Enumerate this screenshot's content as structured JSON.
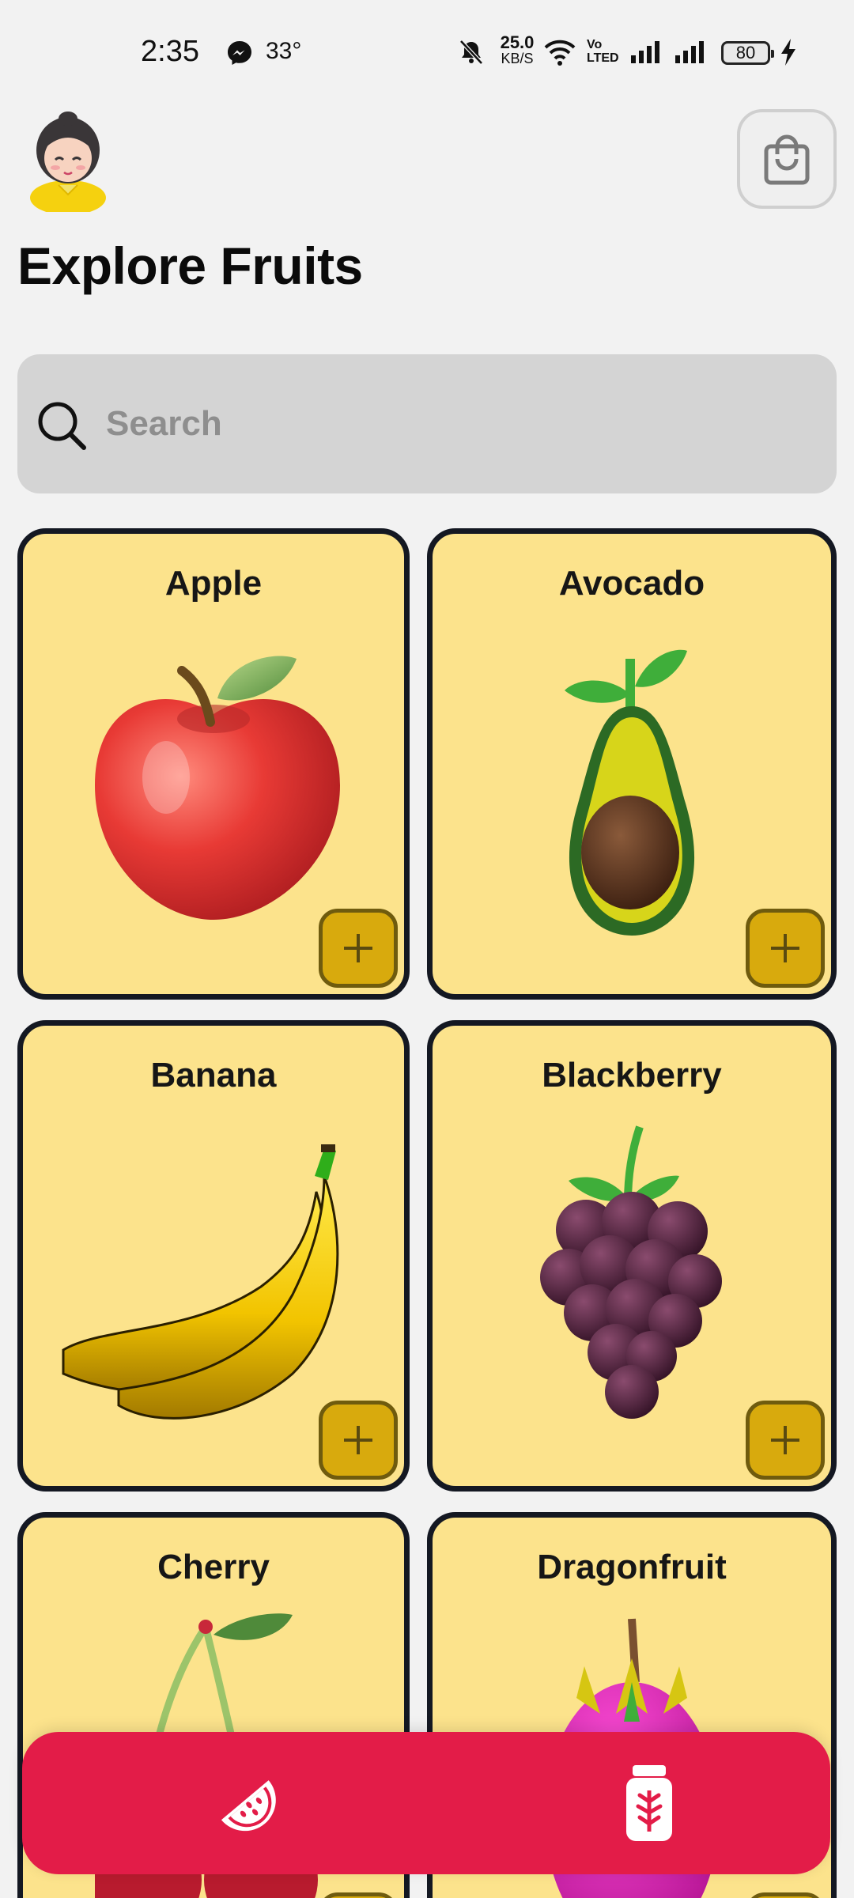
{
  "status_bar": {
    "time": "2:35",
    "temperature": "33°",
    "net_speed": "25.0",
    "net_unit": "KB/S",
    "volte": [
      "Vo",
      "LTED"
    ],
    "battery": "80"
  },
  "header": {
    "title": "Explore Fruits",
    "avatar_icon": "girl-avatar",
    "cart_icon": "shopping-bag-icon"
  },
  "search": {
    "placeholder": "Search",
    "value": ""
  },
  "fruits": [
    {
      "name": "Apple"
    },
    {
      "name": "Avocado"
    },
    {
      "name": "Banana"
    },
    {
      "name": "Blackberry"
    },
    {
      "name": "Cherry"
    },
    {
      "name": "Dragonfruit"
    }
  ],
  "bottom_nav": {
    "items": [
      {
        "icon": "watermelon-icon"
      },
      {
        "icon": "juice-jar-icon"
      }
    ]
  },
  "colors": {
    "background": "#f2f2f2",
    "card": "#fce38c",
    "card_border": "#141822",
    "add_button": "#d8aa0d",
    "nav": "#e31c48"
  }
}
